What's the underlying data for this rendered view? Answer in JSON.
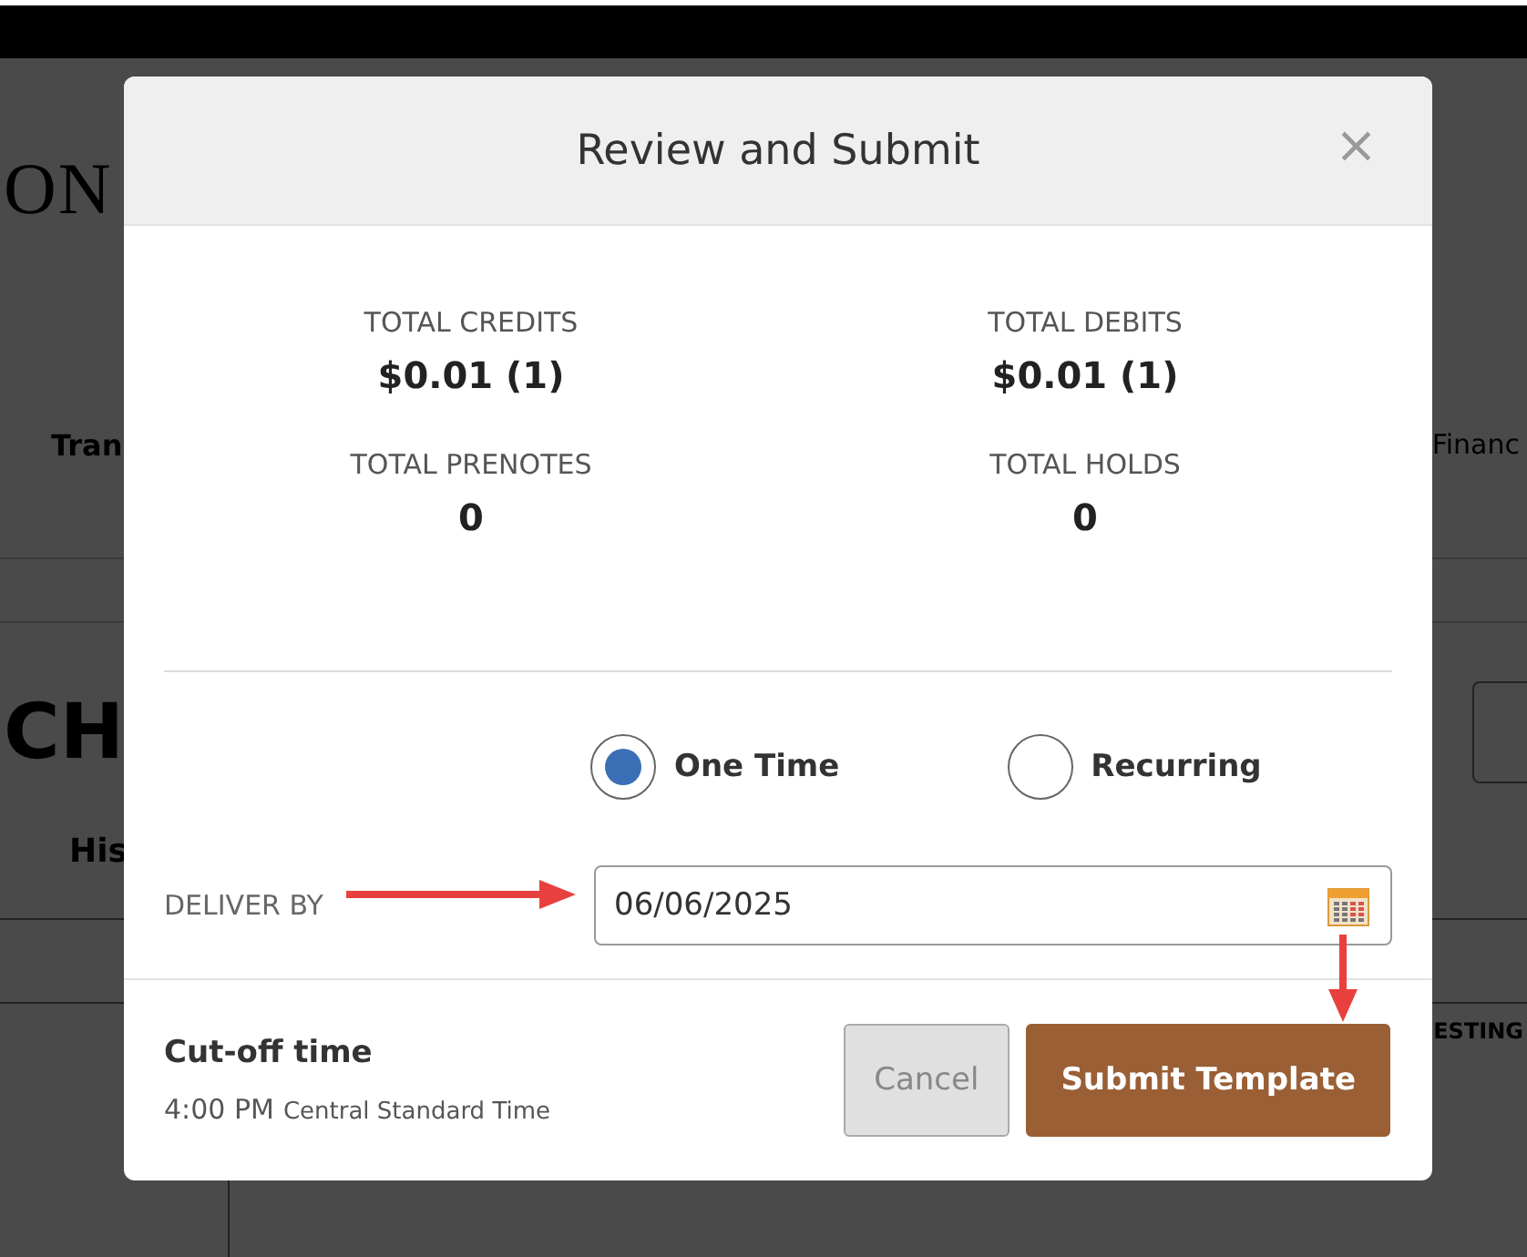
{
  "background": {
    "brand": "ON",
    "nav_left": "Tran",
    "nav_right": "Financ",
    "heading": "CH",
    "tab": "His",
    "column_right": "ESTING"
  },
  "dialog": {
    "title": "Review and Submit",
    "close": "×",
    "totals": [
      {
        "label": "TOTAL CREDITS",
        "value": "$0.01 (1)"
      },
      {
        "label": "TOTAL DEBITS",
        "value": "$0.01 (1)"
      },
      {
        "label": "TOTAL PRENOTES",
        "value": "0"
      },
      {
        "label": "TOTAL HOLDS",
        "value": "0"
      }
    ],
    "frequency": [
      {
        "label": "One Time",
        "selected": true
      },
      {
        "label": "Recurring",
        "selected": false
      }
    ],
    "deliver_by": {
      "label": "DELIVER BY",
      "value": "06/06/2025"
    },
    "cutoff": {
      "title": "Cut-off time",
      "time": "4:00 PM",
      "zone": "Central Standard Time"
    },
    "buttons": [
      {
        "label": "Cancel",
        "kind": "secondary"
      },
      {
        "label": "Submit Template",
        "kind": "primary"
      }
    ]
  }
}
